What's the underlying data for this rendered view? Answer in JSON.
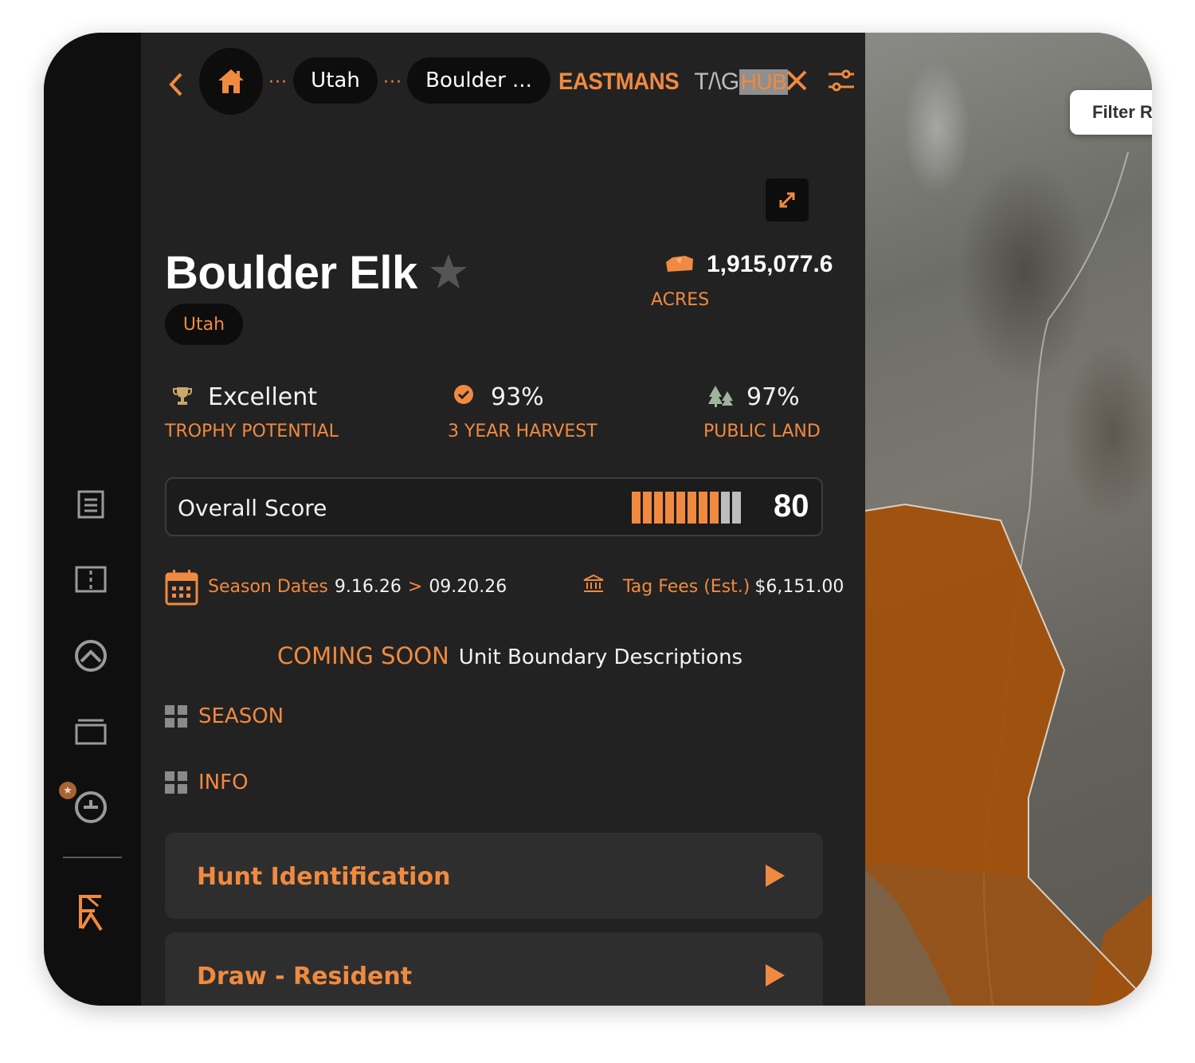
{
  "header": {
    "crumb_state": "Utah",
    "crumb_unit": "Boulder ...",
    "dots": "···",
    "brand_main": "EASTMANS",
    "brand_tag": "T/\\G",
    "brand_hub": "HUB"
  },
  "unit": {
    "title": "Boulder Elk",
    "state": "Utah",
    "acres_value": "1,915,077.6",
    "acres_label": "ACRES"
  },
  "stats": [
    {
      "value": "Excellent",
      "label": "TROPHY POTENTIAL",
      "icon": "trophy-icon"
    },
    {
      "value": "93%",
      "label": "3 YEAR HARVEST",
      "icon": "check-circle-icon"
    },
    {
      "value": "97%",
      "label": "PUBLIC LAND",
      "icon": "trees-icon"
    }
  ],
  "score": {
    "label": "Overall Score",
    "value": "80",
    "filled_segments": 8,
    "total_segments": 10
  },
  "season": {
    "label": "Season Dates",
    "start": "9.16.26",
    "sep": ">",
    "end": "09.20.26"
  },
  "fees": {
    "label": "Tag Fees (Est.)",
    "value": "$6,151.00"
  },
  "coming": {
    "tag": "COMING SOON",
    "text": "Unit Boundary Descriptions"
  },
  "sections": [
    "SEASON",
    "INFO"
  ],
  "accordions": [
    "Hunt Identification",
    "Draw - Resident"
  ],
  "map": {
    "filter_label": "Filter R"
  },
  "colors": {
    "accent": "#f08a40",
    "panel": "#222222",
    "rail": "#0f0f0f",
    "unit_overlay": "#a0520f"
  }
}
